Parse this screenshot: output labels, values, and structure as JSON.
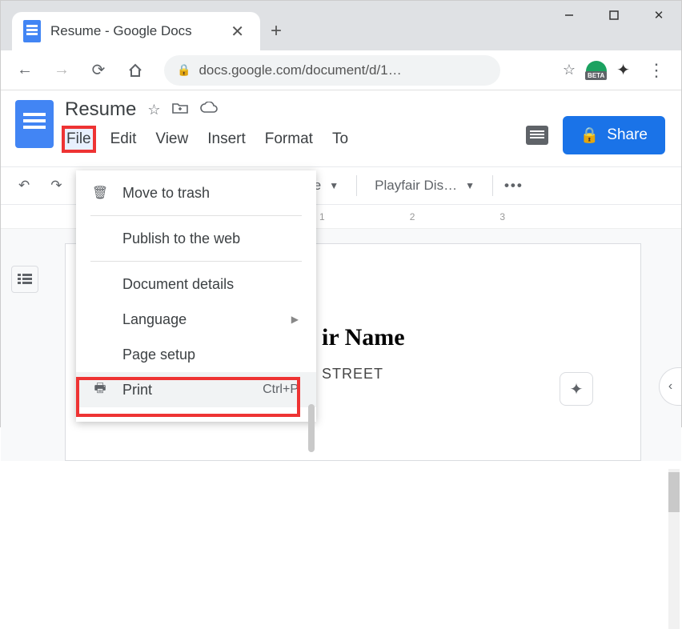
{
  "browser": {
    "tab_title": "Resume - Google Docs",
    "url_display": "docs.google.com/document/d/1…",
    "beta_label": "BETA"
  },
  "docs_header": {
    "title": "Resume",
    "menus": {
      "file": "File",
      "edit": "Edit",
      "view": "View",
      "insert": "Insert",
      "format": "Format",
      "tools_cut": "To"
    },
    "share_label": "Share"
  },
  "toolbar": {
    "style_label": "itle",
    "font_label": "Playfair Dis…"
  },
  "ruler": {
    "t1": "1",
    "t2": "2",
    "t3": "3"
  },
  "document": {
    "heading_fragment": "ir Name",
    "street_fragment": "STREET"
  },
  "file_menu": {
    "move_to_trash": "Move to trash",
    "publish": "Publish to the web",
    "doc_details": "Document details",
    "language": "Language",
    "page_setup": "Page setup",
    "print": "Print",
    "print_shortcut": "Ctrl+P"
  }
}
